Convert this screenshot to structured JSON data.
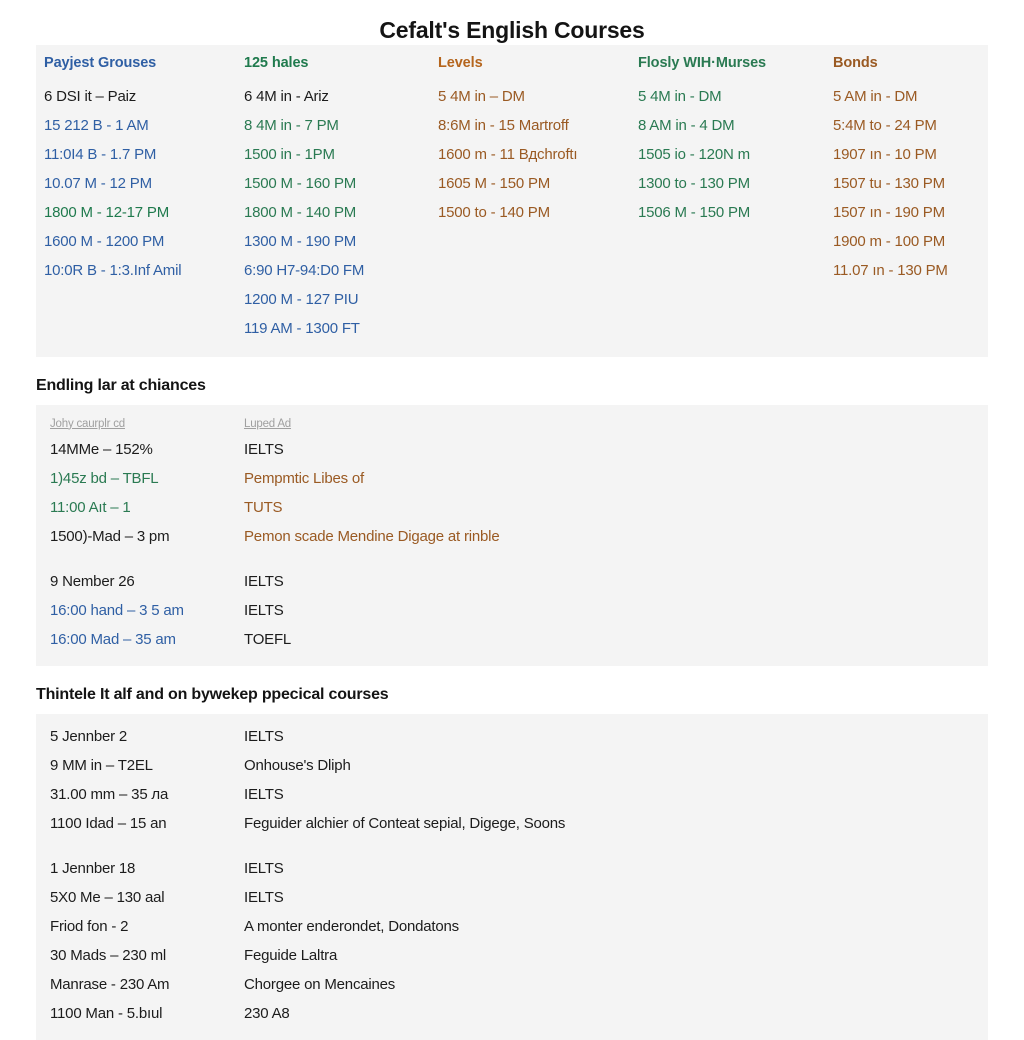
{
  "title": "Cefalt's English Courses",
  "schedule": {
    "columns": [
      {
        "header": "Payjest Grouses",
        "header_color": "t-blue",
        "rows": [
          {
            "text": "6 DSI it – Paiz",
            "color": "t-dark"
          },
          {
            "text": "15 212 B - 1 AM",
            "color": "t-blue"
          },
          {
            "text": "11:0I4 B - 1.7 PM",
            "color": "t-blue"
          },
          {
            "text": "10.07 M - 12 PM",
            "color": "t-blue"
          },
          {
            "text": "1800 M - 12-17 PM",
            "color": "t-green"
          },
          {
            "text": "1600 M - 1200 PM",
            "color": "t-blue"
          },
          {
            "text": "10:0R B - 1:3.Inf Amil",
            "color": "t-blue"
          }
        ]
      },
      {
        "header": "125 hales",
        "header_color": "t-green",
        "rows": [
          {
            "text": "6 4M in - Ariz",
            "color": "t-dark"
          },
          {
            "text": "8 4M in - 7 PM",
            "color": "t-dgreen"
          },
          {
            "text": "1500 in - 1PM",
            "color": "t-dgreen"
          },
          {
            "text": "1500 M - 160 PM",
            "color": "t-dgreen"
          },
          {
            "text": "1800 M - 140 PM",
            "color": "t-dgreen"
          },
          {
            "text": "1300 M - 190 PM",
            "color": "t-blue"
          },
          {
            "text": "6:90 H7-94:D0 FM",
            "color": "t-blue"
          },
          {
            "text": "1200 M - 127 PIU",
            "color": "t-blue"
          },
          {
            "text": "119 AM - 1300 FT",
            "color": "t-blue"
          }
        ]
      },
      {
        "header": "Levels",
        "header_color": "t-orange",
        "rows": [
          {
            "text": "5 4M in – DM",
            "color": "t-brown"
          },
          {
            "text": "8:6M in - 15 Martroff",
            "color": "t-brown"
          },
          {
            "text": "1600 m - 11 Bдchroftı",
            "color": "t-brown"
          },
          {
            "text": "1605 M - 150 PM",
            "color": "t-brown"
          },
          {
            "text": "1500 to - 140 PM",
            "color": "t-brown"
          }
        ]
      },
      {
        "header": "Flosly WIH·Murses",
        "header_color": "t-dgreen",
        "rows": [
          {
            "text": "5 4M in - DM",
            "color": "t-dgreen"
          },
          {
            "text": "8 AM in - 4 DM",
            "color": "t-dgreen"
          },
          {
            "text": "1505 io - 120N m",
            "color": "t-dgreen"
          },
          {
            "text": "1300 to - 130 PM",
            "color": "t-dgreen"
          },
          {
            "text": "1506 M - 150 PM",
            "color": "t-dgreen"
          }
        ]
      },
      {
        "header": "Bonds",
        "header_color": "t-brown",
        "rows": [
          {
            "text": "5 AM in - DM",
            "color": "t-brown"
          },
          {
            "text": "5:4M to - 24 PM",
            "color": "t-brown"
          },
          {
            "text": "1907 ın - 10 PM",
            "color": "t-brown"
          },
          {
            "text": "1507 tu - 130 PM",
            "color": "t-brown"
          },
          {
            "text": "1507 ın - 190 PM",
            "color": "t-brown"
          },
          {
            "text": "1900 m - 100 PM",
            "color": "t-brown"
          },
          {
            "text": "11.07 ın - 130 PM",
            "color": "t-brown"
          }
        ]
      }
    ]
  },
  "section2": {
    "title": "Endling lar at chiances",
    "subheaders": {
      "left": "Johy caurplr cd",
      "right": "Luped Ad"
    },
    "groups": [
      {
        "rows": [
          {
            "left": "14MMe – 152%",
            "left_color": "t-dark",
            "right": "IELTS",
            "right_color": "t-dark"
          },
          {
            "left": "1)45z bd – TBFL",
            "left_color": "t-dgreen",
            "right": "Pempmtic Libes of",
            "right_color": "t-brown"
          },
          {
            "left": "11:00 Aıt – 1",
            "left_color": "t-dgreen",
            "right": "TUTS",
            "right_color": "t-brown"
          },
          {
            "left": "1500)-Mad – 3 pm",
            "left_color": "t-dark",
            "right": "Pemon scade Mendine Digage at rinble",
            "right_color": "t-brown"
          }
        ]
      },
      {
        "rows": [
          {
            "left": "9 Nember 26",
            "left_color": "t-dark",
            "right": "IELTS",
            "right_color": "t-dark"
          },
          {
            "left": "16:00 hand – 3 5 am",
            "left_color": "t-blue",
            "right": "IELTS",
            "right_color": "t-dark"
          },
          {
            "left": "16:00 Mad – 35 am",
            "left_color": "t-blue",
            "right": "TOEFL",
            "right_color": "t-dark"
          }
        ]
      }
    ]
  },
  "section3": {
    "title": "Thintele It alf and on bywekep ppecical courses",
    "groups": [
      {
        "rows": [
          {
            "left": "5 Jennber 2",
            "left_color": "t-dark",
            "right": "IELTS",
            "right_color": "t-dark"
          },
          {
            "left": "9 MM in – T2EL",
            "left_color": "t-dark",
            "right": "Onhouse's Dliph",
            "right_color": "t-dark"
          },
          {
            "left": "31.00 mm – 35 лa",
            "left_color": "t-dark",
            "right": "IELTS",
            "right_color": "t-dark"
          },
          {
            "left": "1100 Idad – 15 an",
            "left_color": "t-dark",
            "right": "Feguider alchier of Conteat sepial, Digege, Soons",
            "right_color": "t-dark"
          }
        ]
      },
      {
        "rows": [
          {
            "left": "1 Jennber 18",
            "left_color": "t-dark",
            "right": "IELTS",
            "right_color": "t-dark"
          },
          {
            "left": "5X0 Me – 130 aal",
            "left_color": "t-dark",
            "right": "IELTS",
            "right_color": "t-dark"
          },
          {
            "left": "Friod fon - 2",
            "left_color": "t-dark",
            "right": "A monter enderondet, Dondatons",
            "right_color": "t-dark"
          },
          {
            "left": "30 Mads – 230 ml",
            "left_color": "t-dark",
            "right": "Feguide Laltra",
            "right_color": "t-dark"
          },
          {
            "left": "Manrase - 230 Am",
            "left_color": "t-dark",
            "right": "Chorgee on Mencaines",
            "right_color": "t-dark"
          },
          {
            "left": "1100 Man - 5.bıul",
            "left_color": "t-dark",
            "right": "230 A8",
            "right_color": "t-dark"
          }
        ]
      }
    ]
  }
}
